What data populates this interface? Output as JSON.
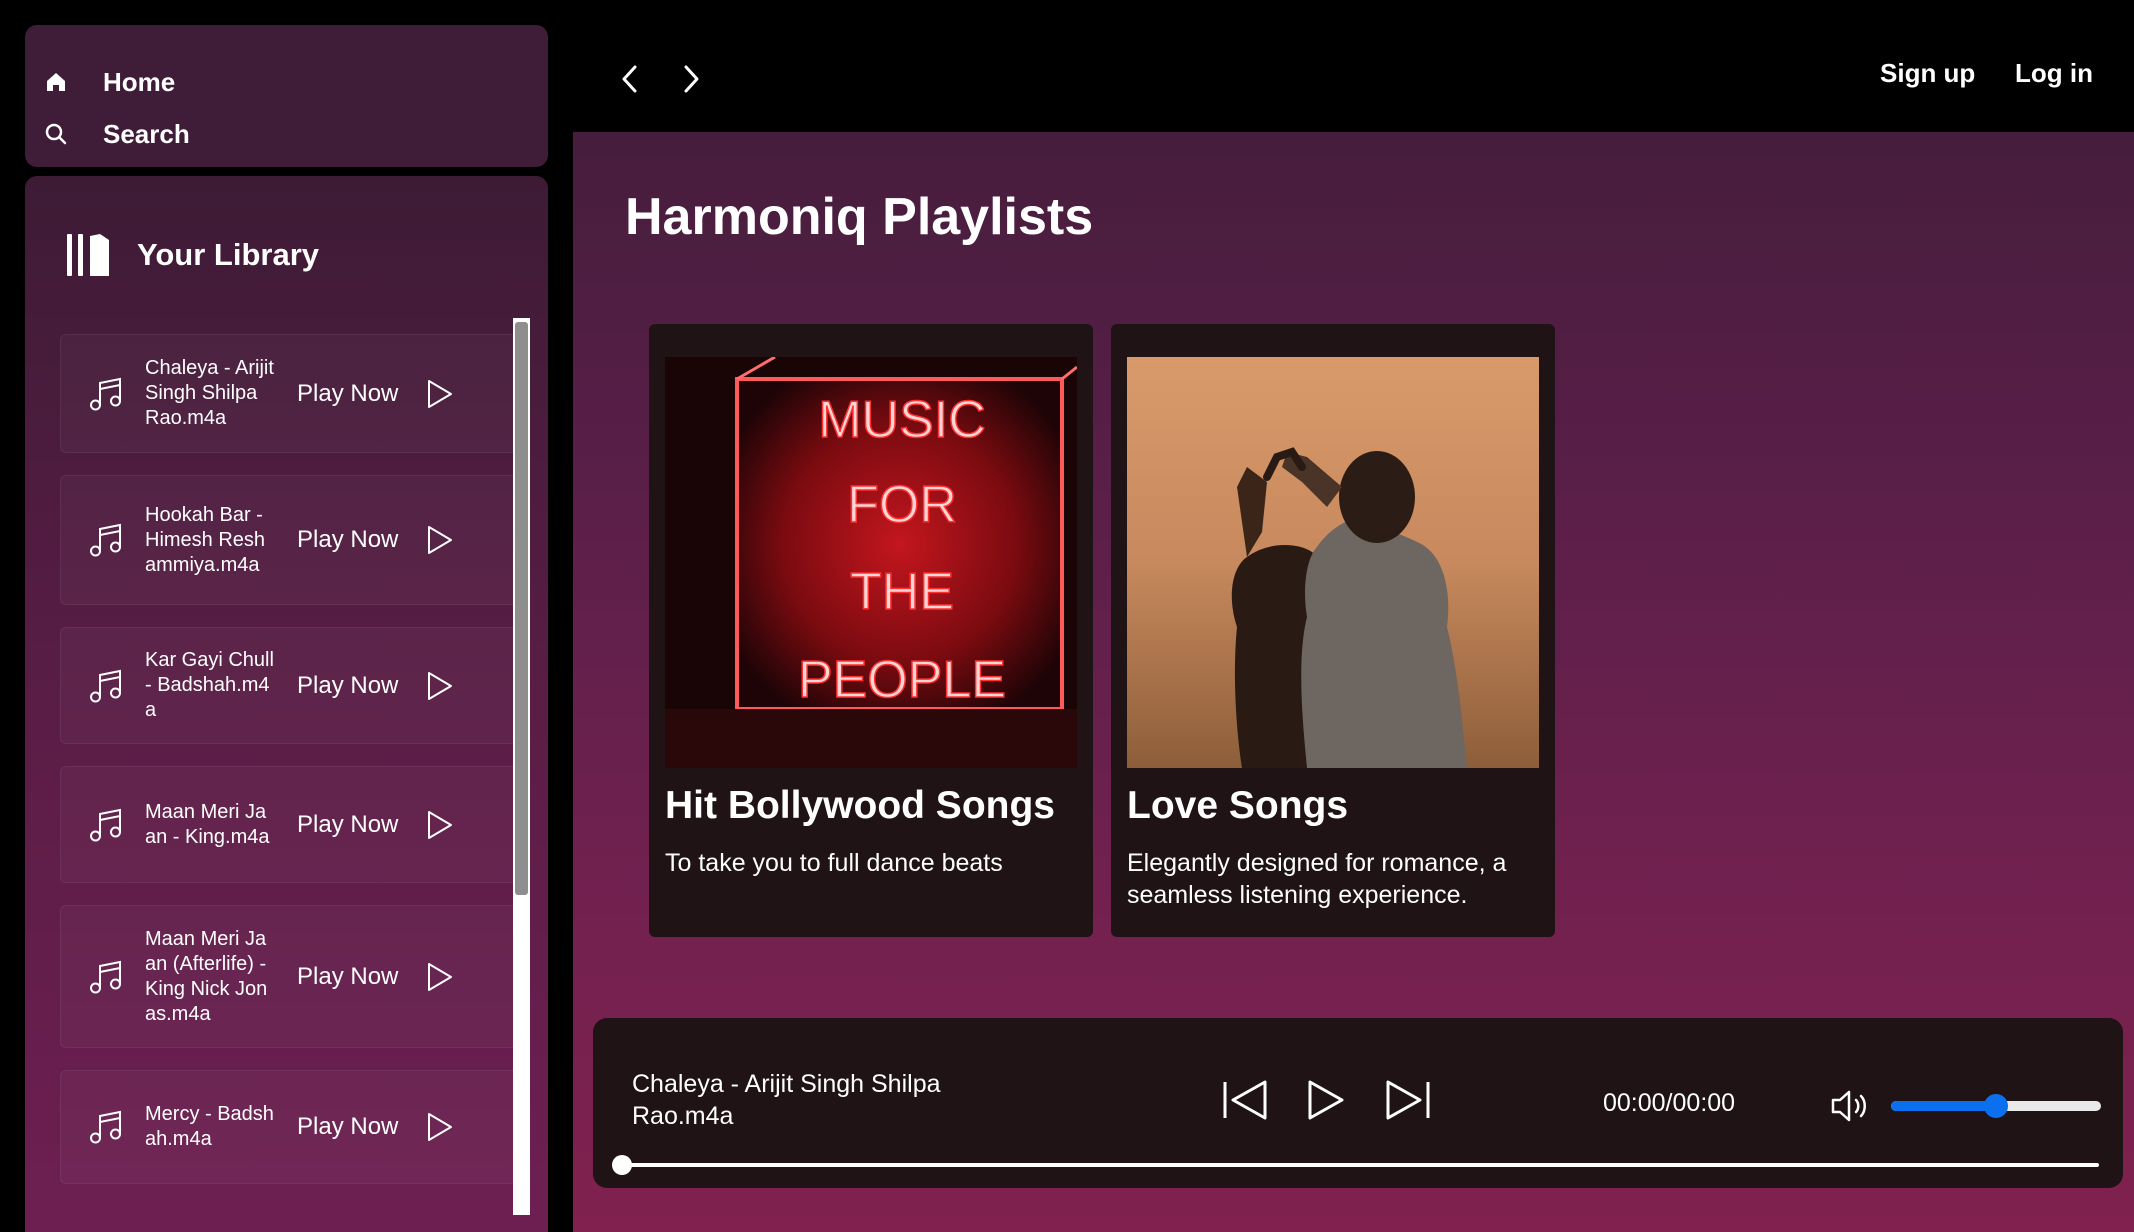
{
  "nav": {
    "home_label": "Home",
    "search_label": "Search"
  },
  "library": {
    "title": "Your Library",
    "play_label": "Play Now",
    "songs": [
      {
        "name": "Chaleya - Arijit Singh Shilpa Rao.m4a"
      },
      {
        "name": "Hookah Bar - Himesh Reshammiya.m4a"
      },
      {
        "name": "Kar Gayi Chull - Badshah.m4a"
      },
      {
        "name": "Maan Meri Jaan - King.m4a"
      },
      {
        "name": "Maan Meri Jaan (Afterlife) - King Nick Jonas.m4a"
      },
      {
        "name": "Mercy - Badshah.m4a"
      }
    ]
  },
  "topbar": {
    "signup_label": "Sign up",
    "login_label": "Log in"
  },
  "main": {
    "title": "Harmoniq Playlists",
    "cards": [
      {
        "title": "Hit Bollywood Songs",
        "desc": "To take you to full dance beats",
        "art_text": [
          "MUSIC",
          "FOR",
          "THE",
          "PEOPLE"
        ]
      },
      {
        "title": "Love Songs",
        "desc": "Elegantly designed for romance, a seamless listening experience."
      }
    ]
  },
  "player": {
    "now_playing": "Chaleya - Arijit Singh Shilpa Rao.m4a",
    "time": "00:00/00:00",
    "volume_fraction": 0.5,
    "progress_fraction": 0.0
  },
  "colors": {
    "accent": "#0a70f0",
    "sidebar_bg": "#3f1c37",
    "card_bg": "#1f1315"
  }
}
